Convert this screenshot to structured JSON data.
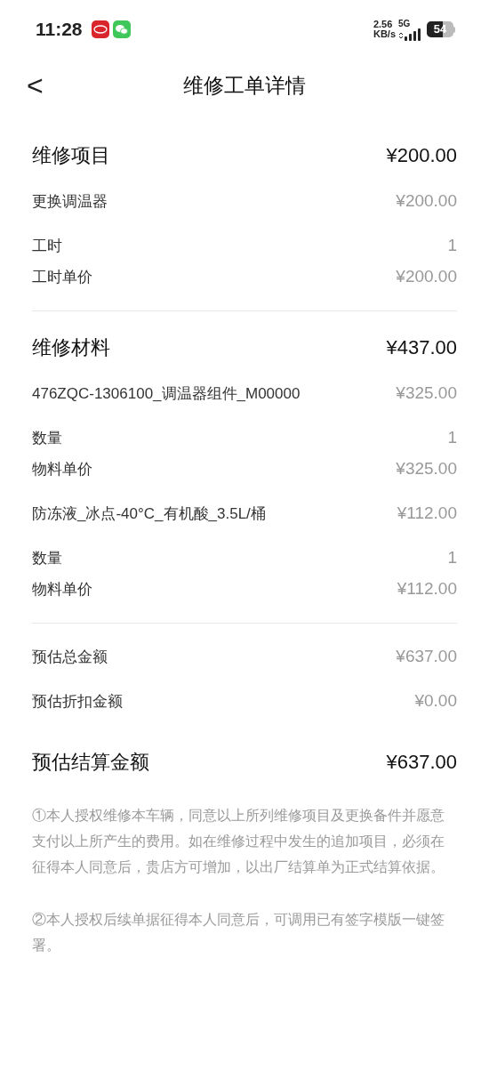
{
  "status_bar": {
    "time": "11:28",
    "speed": "2.56",
    "speed_unit": "KB/s",
    "network": "5G",
    "battery": "54"
  },
  "header": {
    "back": "<",
    "title": "维修工单详情"
  },
  "sections": [
    {
      "rows": [
        {
          "kind": "heading",
          "label": "维修项目",
          "value": "¥200.00"
        },
        {
          "kind": "item",
          "label": "更换调温器",
          "value": "¥200.00"
        },
        {
          "kind": "detail",
          "label": "工时",
          "value": "1"
        },
        {
          "kind": "detail",
          "label": "工时单价",
          "value": "¥200.00"
        }
      ]
    },
    {
      "rows": [
        {
          "kind": "heading",
          "label": "维修材料",
          "value": "¥437.00"
        },
        {
          "kind": "item",
          "label": "476ZQC-1306100_调温器组件_M00000",
          "value": "¥325.00"
        },
        {
          "kind": "detail",
          "label": "数量",
          "value": "1"
        },
        {
          "kind": "detail",
          "label": "物料单价",
          "value": "¥325.00"
        },
        {
          "kind": "item",
          "label": "防冻液_冰点-40°C_有机酸_3.5L/桶",
          "value": "¥112.00"
        },
        {
          "kind": "detail",
          "label": "数量",
          "value": "1"
        },
        {
          "kind": "detail",
          "label": "物料单价",
          "value": "¥112.00"
        }
      ]
    },
    {
      "rows": [
        {
          "kind": "item",
          "label": "预估总金额",
          "value": "¥637.00"
        },
        {
          "kind": "item",
          "label": "预估折扣金额",
          "value": "¥0.00"
        },
        {
          "kind": "heading",
          "label": "预估结算金额",
          "value": "¥637.00"
        }
      ]
    }
  ],
  "notes": [
    "①本人授权维修本车辆，同意以上所列维修项目及更换备件并愿意支付以上所产生的费用。如在维修过程中发生的追加项目，必须在征得本人同意后，贵店方可增加，以出厂结算单为正式结算依据。",
    "②本人授权后续单据征得本人同意后，可调用已有签字模版一键签署。"
  ]
}
